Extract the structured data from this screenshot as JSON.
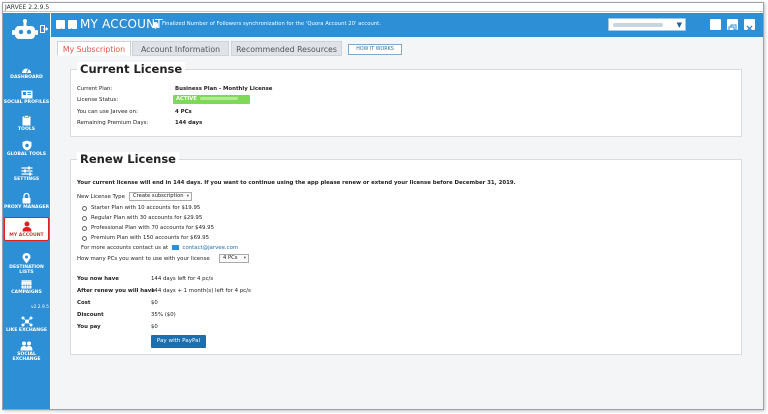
{
  "app": {
    "title": "JARVEE 2.2.9.5",
    "version": "v2.2.9.5"
  },
  "header": {
    "title": "MY ACCOUNT",
    "notification": "Finalized Number of Followers synchronization for the 'Quora Account 20' account."
  },
  "sidebar": {
    "items": [
      {
        "label": "DASHBOARD",
        "icon": "gauge-icon"
      },
      {
        "label": "SOCIAL PROFILES",
        "icon": "profiles-icon"
      },
      {
        "label": "TOOLS",
        "icon": "clipboard-icon"
      },
      {
        "label": "GLOBAL TOOLS",
        "icon": "shield-icon"
      },
      {
        "label": "SETTINGS",
        "icon": "sliders-icon"
      },
      {
        "label": "PROXY MANAGER",
        "icon": "lock-icon"
      },
      {
        "label": "MY ACCOUNT",
        "icon": "user-icon"
      },
      {
        "label": "DESTINATION LISTS",
        "icon": "map-pin-icon"
      },
      {
        "label": "CAMPAIGNS",
        "icon": "calendar-icon"
      },
      {
        "label": "LIKE EXCHANGE",
        "icon": "network-icon"
      },
      {
        "label": "SOCIAL EXCHANGE",
        "icon": "users-icon"
      }
    ]
  },
  "tabs": [
    {
      "label": "My Subscription",
      "active": true
    },
    {
      "label": "Account Information",
      "active": false
    },
    {
      "label": "Recommended Resources",
      "active": false
    }
  ],
  "how_it_works": "HOW IT WORKS",
  "current_license": {
    "title": "Current License",
    "rows": [
      {
        "label": "Current Plan:",
        "value": "Business Plan - Monthly License"
      },
      {
        "label": "License Status:",
        "value": "ACTIVE"
      },
      {
        "label": "You can use Jarvee on:",
        "value": "4 PCs"
      },
      {
        "label": "Remaining Premium Days:",
        "value": "144 days"
      }
    ]
  },
  "renew_license": {
    "title": "Renew License",
    "notice": "Your current license will end in 144 days. If you want to continue using the app please renew or extend your license before December 31, 2019.",
    "type_label": "New License Type",
    "type_value": "Create subscription",
    "plans": [
      "Starter Plan with 10 accounts for $19.95",
      "Regular Plan with 30 accounts for $29.95",
      "Professional Plan with 70 accounts for $49.95",
      "Premium Plan with 150 accounts for $69.95"
    ],
    "contact_text": "For more accounts contact us at",
    "contact_email": "contact@jarvee.com",
    "pcs_label": "How many PCs you want to use with your license",
    "pcs_value": "4 PCs",
    "summary": [
      {
        "label": "You now have",
        "value": "144 days left for 4 pc/s"
      },
      {
        "label": "After renew you will have",
        "value": "144 days + 1 month(s) left for 4 pc/s"
      },
      {
        "label": "Cost",
        "value": "$0"
      },
      {
        "label": "Discount",
        "value": "35% ($0)"
      },
      {
        "label": "You pay",
        "value": "$0"
      }
    ],
    "pay_button": "Pay with PayPal"
  },
  "colors": {
    "sidebar": "#2d8fd5",
    "active_tab": "#e0544a",
    "active_badge": "#7ed957",
    "paypal": "#1a6fb0"
  }
}
